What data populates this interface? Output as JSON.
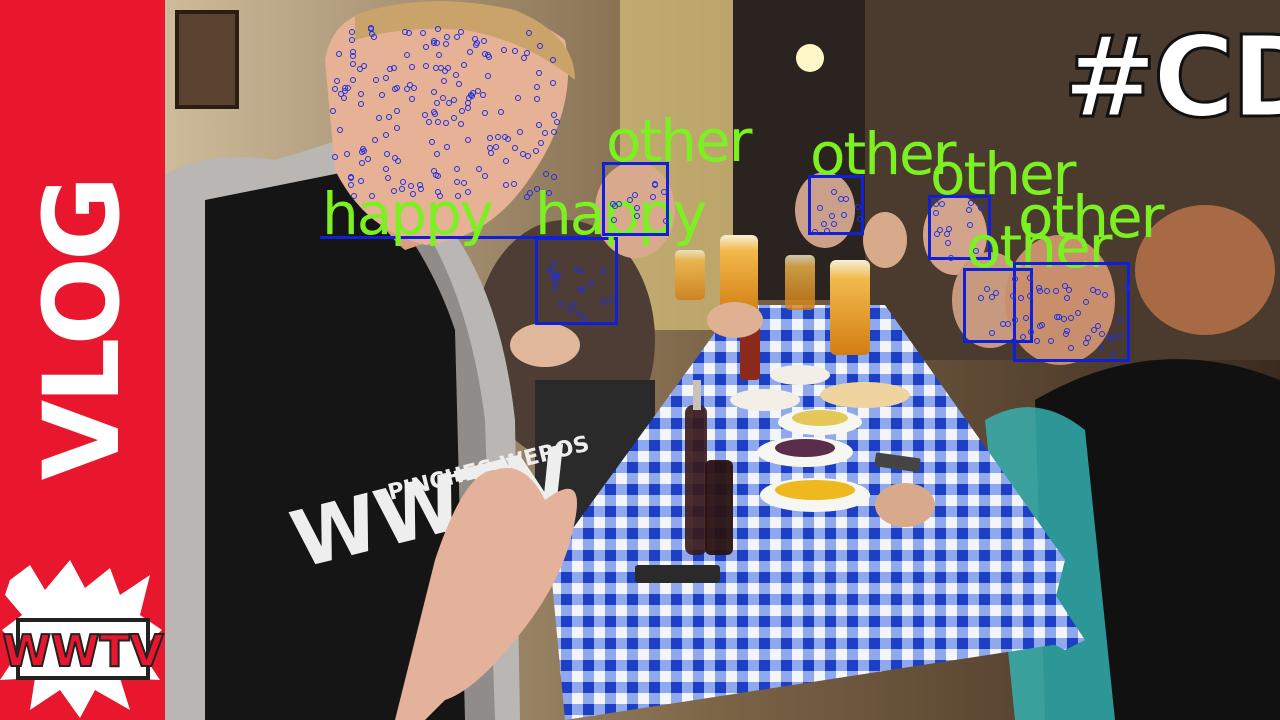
{
  "banner": {
    "vertical_text": "VLOG",
    "logo_text": "WWTV",
    "color": "#e8172d"
  },
  "photo": {
    "hashtag": "#CDMX",
    "shirt_text": "PINCHES WEROS",
    "shirt_logo": "WWTV"
  },
  "detections": [
    {
      "label": "happy"
    },
    {
      "label": "happy"
    },
    {
      "label": "other"
    },
    {
      "label": "other"
    },
    {
      "label": "other"
    },
    {
      "label": "other"
    },
    {
      "label": "other"
    }
  ],
  "colors": {
    "box": "#1020d8",
    "label": "#7cf022",
    "tablecloth_blue": "#2a4fd6"
  }
}
